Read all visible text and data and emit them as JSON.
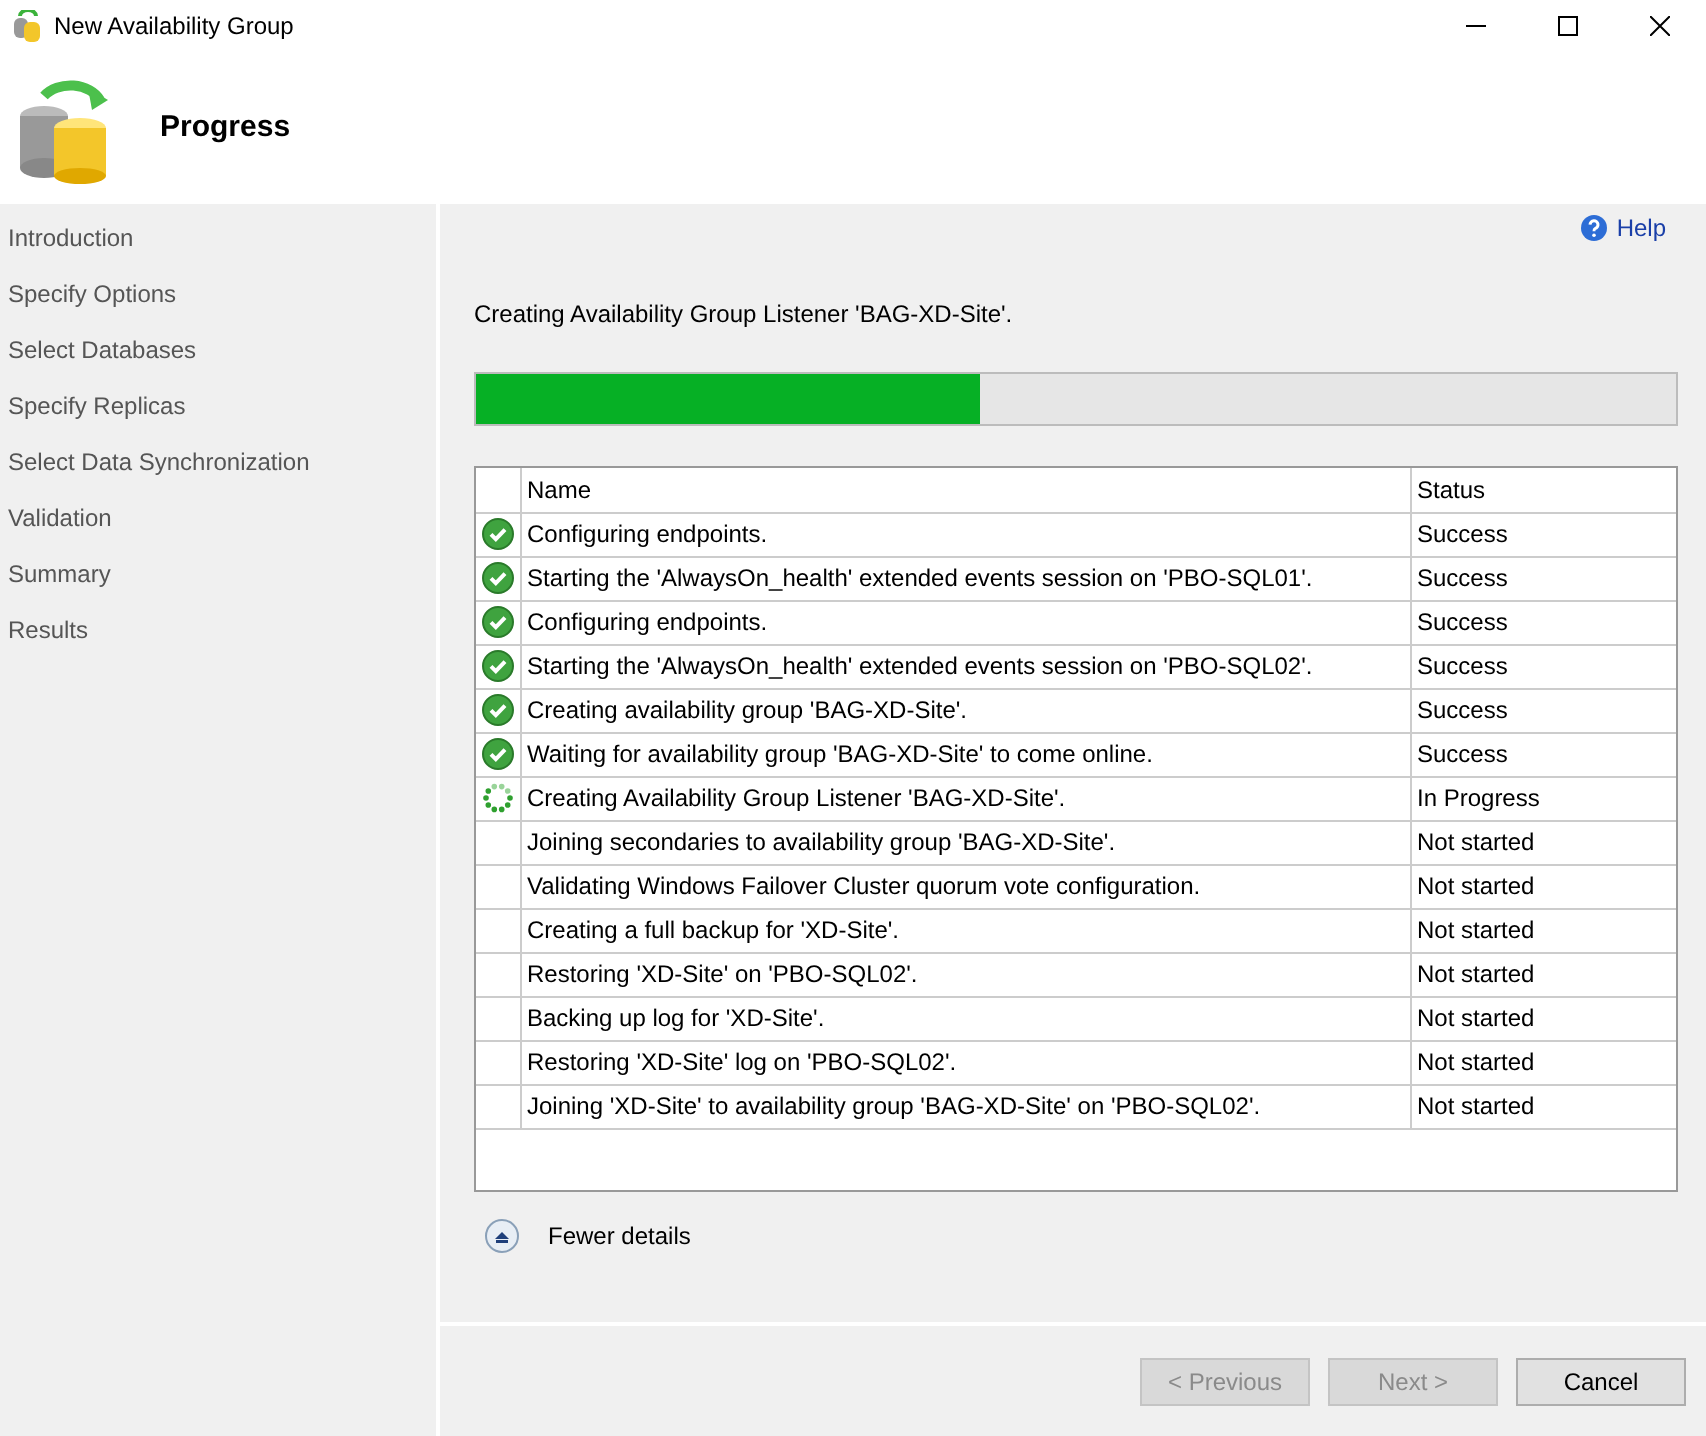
{
  "window": {
    "title": "New Availability Group"
  },
  "header": {
    "title": "Progress"
  },
  "sidebar": {
    "items": [
      {
        "label": "Introduction"
      },
      {
        "label": "Specify Options"
      },
      {
        "label": "Select Databases"
      },
      {
        "label": "Specify Replicas"
      },
      {
        "label": "Select Data Synchronization"
      },
      {
        "label": "Validation"
      },
      {
        "label": "Summary"
      },
      {
        "label": "Results"
      }
    ]
  },
  "help": {
    "label": "Help"
  },
  "current_action": "Creating Availability Group Listener 'BAG-XD-Site'.",
  "progress": {
    "level": 0.42
  },
  "table": {
    "columns": [
      "Name",
      "Status"
    ],
    "rows": [
      {
        "kind": "success",
        "name": "Configuring endpoints.",
        "status": "Success"
      },
      {
        "kind": "success",
        "name": "Starting the 'AlwaysOn_health' extended events session on 'PBO-SQL01'.",
        "status": "Success"
      },
      {
        "kind": "success",
        "name": "Configuring endpoints.",
        "status": "Success"
      },
      {
        "kind": "success",
        "name": "Starting the 'AlwaysOn_health' extended events session on 'PBO-SQL02'.",
        "status": "Success"
      },
      {
        "kind": "success",
        "name": "Creating availability group 'BAG-XD-Site'.",
        "status": "Success"
      },
      {
        "kind": "success",
        "name": "Waiting for availability group 'BAG-XD-Site' to come online.",
        "status": "Success"
      },
      {
        "kind": "in_progress",
        "name": "Creating Availability Group Listener 'BAG-XD-Site'.",
        "status": "In Progress"
      },
      {
        "kind": "pending",
        "name": "Joining secondaries to availability group 'BAG-XD-Site'.",
        "status": "Not started"
      },
      {
        "kind": "pending",
        "name": "Validating Windows Failover Cluster quorum vote configuration.",
        "status": "Not started"
      },
      {
        "kind": "pending",
        "name": "Creating a full backup for 'XD-Site'.",
        "status": "Not started"
      },
      {
        "kind": "pending",
        "name": "Restoring 'XD-Site' on 'PBO-SQL02'.",
        "status": "Not started"
      },
      {
        "kind": "pending",
        "name": "Backing up log for 'XD-Site'.",
        "status": "Not started"
      },
      {
        "kind": "pending",
        "name": "Restoring 'XD-Site' log on 'PBO-SQL02'.",
        "status": "Not started"
      },
      {
        "kind": "pending",
        "name": "Joining 'XD-Site' to availability group 'BAG-XD-Site' on 'PBO-SQL02'.",
        "status": "Not started"
      }
    ]
  },
  "details_toggle": {
    "label": "Fewer details"
  },
  "buttons": [
    {
      "label": "< Previous",
      "disabled": true
    },
    {
      "label": "Next >",
      "disabled": true
    },
    {
      "label": "Cancel",
      "disabled": false
    }
  ]
}
